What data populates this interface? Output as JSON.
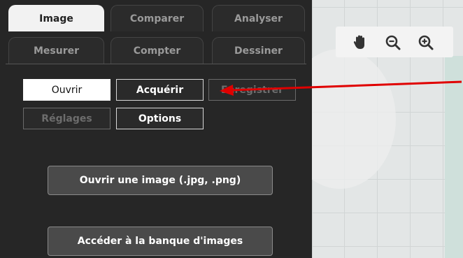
{
  "tabs": {
    "row1": [
      {
        "label": "Image",
        "active": true
      },
      {
        "label": "Comparer",
        "active": false
      },
      {
        "label": "Analyser",
        "active": false
      }
    ],
    "row2": [
      {
        "label": "Mesurer",
        "active": false
      },
      {
        "label": "Compter",
        "active": false
      },
      {
        "label": "Dessiner",
        "active": false
      }
    ]
  },
  "buttons": {
    "open": "Ouvrir",
    "acquire": "Acquérir",
    "save": "Enregistrer",
    "settings": "Réglages",
    "options": "Options"
  },
  "actions": {
    "open_image": "Ouvrir une image (.jpg, .png)",
    "image_bank": "Accéder à la banque d'images"
  },
  "toolbar": {
    "icons": [
      "hand-icon",
      "zoom-out-icon",
      "zoom-in-icon"
    ]
  },
  "colors": {
    "panel_bg": "#262626",
    "annotation_arrow": "#e00000"
  }
}
